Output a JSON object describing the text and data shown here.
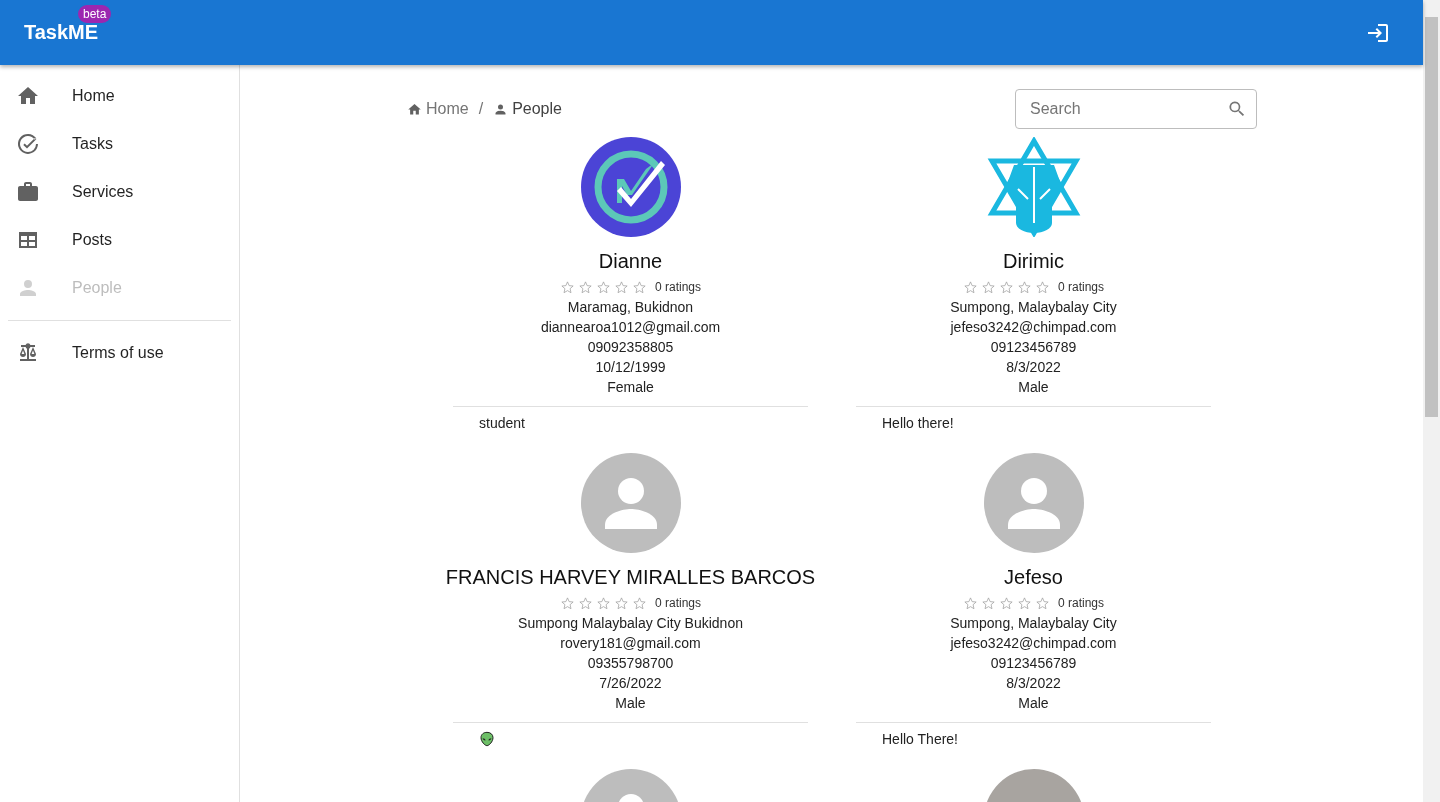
{
  "app_bar": {
    "title": "TaskME",
    "badge": "beta"
  },
  "sidebar": {
    "items": [
      {
        "label": "Home",
        "selected": false
      },
      {
        "label": "Tasks",
        "selected": false
      },
      {
        "label": "Services",
        "selected": false
      },
      {
        "label": "Posts",
        "selected": false
      },
      {
        "label": "People",
        "selected": true
      }
    ],
    "footer_items": [
      {
        "label": "Terms of use",
        "selected": false
      }
    ]
  },
  "breadcrumb": [
    {
      "label": "Home"
    },
    {
      "separator": "/",
      "label": "People"
    }
  ],
  "search": {
    "placeholder": "Search"
  },
  "people": [
    {
      "avatar": {
        "kind": "check"
      },
      "name": "Dianne",
      "stars": 0,
      "ratings": "0 ratings",
      "details": [
        "Maramag, Bukidnon",
        "diannearoa1012@gmail.com",
        "09092358805",
        "10/12/1999",
        "Female"
      ],
      "bio": {
        "kind": "text",
        "text": "student"
      }
    },
    {
      "avatar": {
        "kind": "helmet"
      },
      "name": "Dirimic",
      "stars": 0,
      "ratings": "0 ratings",
      "details": [
        "Sumpong, Malaybalay City",
        "jefeso3242@chimpad.com",
        "09123456789",
        "8/3/2022",
        "Male"
      ],
      "bio": {
        "kind": "text",
        "text": "Hello there!"
      }
    },
    {
      "avatar": {
        "kind": "default"
      },
      "name": "FRANCIS HARVEY MIRALLES BARCOS",
      "stars": 0,
      "ratings": "0 ratings",
      "details": [
        "Sumpong Malaybalay City Bukidnon",
        "rovery181@gmail.com",
        "09355798700",
        "7/26/2022",
        "Male"
      ],
      "bio": {
        "kind": "icon"
      }
    },
    {
      "avatar": {
        "kind": "default"
      },
      "name": "Jefeso",
      "stars": 0,
      "ratings": "0 ratings",
      "details": [
        "Sumpong, Malaybalay City",
        "jefeso3242@chimpad.com",
        "09123456789",
        "8/3/2022",
        "Male"
      ],
      "bio": {
        "kind": "text",
        "text": "Hello There!"
      }
    },
    {
      "avatar": {
        "kind": "default"
      }
    },
    {
      "avatar": {
        "kind": "photo"
      }
    }
  ]
}
